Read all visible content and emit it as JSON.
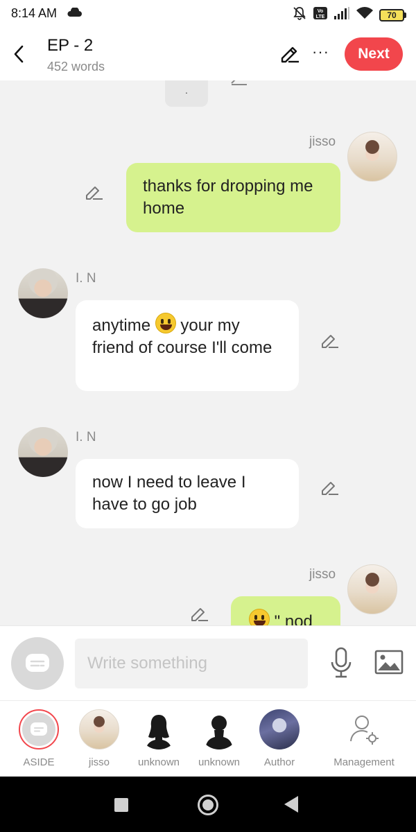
{
  "status_bar": {
    "time": "8:14 AM",
    "icons": [
      "cloud-icon",
      "mute-icon",
      "volte-icon",
      "signal-icon",
      "wifi-icon",
      "battery-icon"
    ],
    "volte": "Vo LTE",
    "battery_level": "70"
  },
  "header": {
    "title": "EP - 2",
    "word_count": "452 words",
    "next_label": "Next",
    "more_label": "···",
    "accent_color": "#f2464c"
  },
  "chat": {
    "partial_top_text": ".",
    "messages": [
      {
        "sender": "jisso",
        "side": "right",
        "text": "thanks for dropping me home"
      },
      {
        "sender": "I. N",
        "side": "left",
        "text_before": "anytime",
        "emoji": "grinning-face",
        "text_after": "your my friend of course I'll come"
      },
      {
        "sender": "I. N",
        "side": "left",
        "text": "now I need to leave I have to go job"
      },
      {
        "sender": "jisso",
        "side": "right",
        "emoji": "slight-smile",
        "text": "\" nod \""
      }
    ],
    "bubble_green": "#d6f28e",
    "bubble_white": "#ffffff"
  },
  "input": {
    "placeholder": "Write something"
  },
  "characters": [
    {
      "label": "ASIDE",
      "selected": true
    },
    {
      "label": "jisso"
    },
    {
      "label": "unknown"
    },
    {
      "label": "unknown"
    },
    {
      "label": "Author"
    },
    {
      "label": "Management"
    }
  ]
}
